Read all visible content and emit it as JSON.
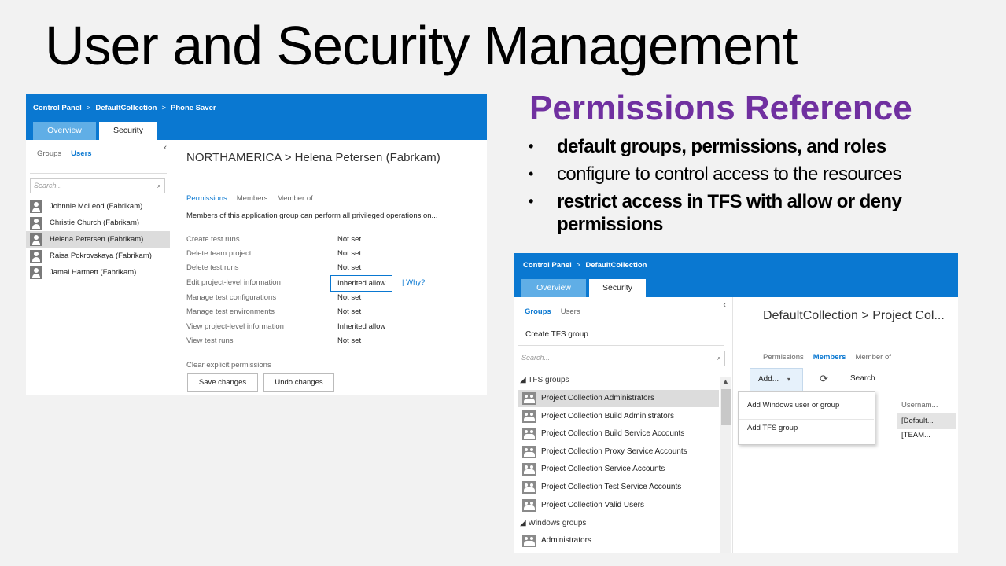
{
  "slide": {
    "title": "User and Security Management",
    "ref_title": "Permissions Reference",
    "bullets": [
      "default groups, permissions, and roles",
      "configure to control access to the resources",
      "restrict access in TFS with allow or deny permissions"
    ]
  },
  "shot1": {
    "breadcrumb": [
      "Control Panel",
      "DefaultCollection",
      "Phone Saver"
    ],
    "crumb_sep": ">",
    "tabs": [
      "Overview",
      "Security"
    ],
    "subtabs": [
      "Groups",
      "Users"
    ],
    "collapse": "‹",
    "search_placeholder": "Search...",
    "search_icon": "⌕",
    "users": [
      "Johnnie McLeod  (Fabrikam)",
      "Christie Church (Fabrikam)",
      "Helena Petersen  (Fabrikam)",
      "Raisa Pokrovskaya  (Fabrikam)",
      "Jamal Hartnett (Fabrikam)"
    ],
    "title": "NORTHAMERICA > Helena Petersen (Fabrkam)",
    "right_tabs": [
      "Permissions",
      "Members",
      "Member of"
    ],
    "description": "Members of this application group can perform all privileged operations on...",
    "permissions": [
      {
        "name": "Create test runs",
        "value": "Not set"
      },
      {
        "name": "Delete team project",
        "value": "Not set"
      },
      {
        "name": "Delete test runs",
        "value": "Not set"
      },
      {
        "name": "Edit project-level information",
        "value": "Inherited allow",
        "why": "| Why?"
      },
      {
        "name": "Manage test configurations",
        "value": "Not set"
      },
      {
        "name": "Manage test environments",
        "value": "Not set"
      },
      {
        "name": "View project-level information",
        "value": "Inherited allow"
      },
      {
        "name": "View test runs",
        "value": "Not set"
      }
    ],
    "clear_link": "Clear explicit permissions",
    "save_label": "Save changes",
    "undo_label": "Undo changes"
  },
  "shot2": {
    "breadcrumb": [
      "Control Panel",
      "DefaultCollection"
    ],
    "crumb_sep": ">",
    "tabs": [
      "Overview",
      "Security"
    ],
    "subtabs": [
      "Groups",
      "Users"
    ],
    "collapse": "‹",
    "create_group": "Create TFS group",
    "search_placeholder": "Search...",
    "search_icon": "⌕",
    "tfs_header": "◢  TFS groups",
    "tfs_groups": [
      "Project Collection Administrators",
      "Project Collection Build Administrators",
      "Project Collection Build Service Accounts",
      "Project Collection Proxy Service Accounts",
      "Project Collection Service Accounts",
      "Project Collection Test Service Accounts",
      "Project Collection Valid Users"
    ],
    "windows_header": "◢  Windows groups",
    "windows_groups": [
      "Administrators"
    ],
    "title": "DefaultCollection > Project Col...",
    "right_tabs": [
      "Permissions",
      "Members",
      "Member of"
    ],
    "add_label": "Add...",
    "add_caret": "▾",
    "refresh_icon": "⟳",
    "search_label": "Search",
    "menu_items": [
      "Add Windows user or group",
      "Add TFS group"
    ],
    "col_header": "Usernam...",
    "cells": [
      "[Default...",
      "[TEAM..."
    ],
    "scroll_up": "▲"
  }
}
